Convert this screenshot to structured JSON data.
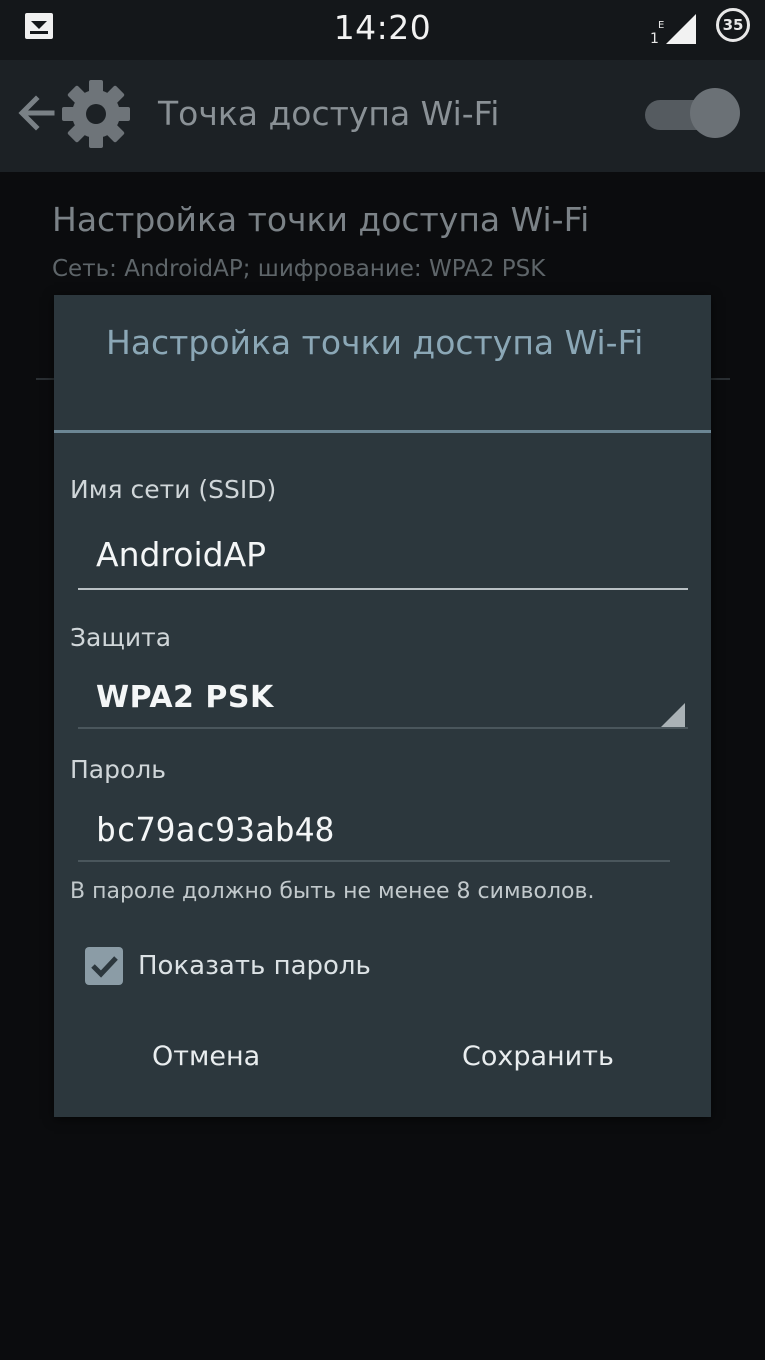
{
  "status_bar": {
    "time": "14:20",
    "battery": "35",
    "icons": [
      "download-notification-icon",
      "signal-icon",
      "battery-icon"
    ]
  },
  "action_bar": {
    "title": "Точка доступа Wi-Fi",
    "toggle_on": true,
    "icons": [
      "back-arrow-icon",
      "gear-icon"
    ]
  },
  "background": {
    "setting_title": "Настройка точки доступа Wi-Fi",
    "setting_summary": "Сеть: AndroidAP; шифрование: WPA2 PSK"
  },
  "dialog": {
    "title": "Настройка точки доступа Wi-Fi",
    "ssid_label": "Имя сети (SSID)",
    "ssid_value": "AndroidAP",
    "security_label": "Защита",
    "security_value": "WPA2 PSK",
    "password_label": "Пароль",
    "password_value": "bc79ac93ab48",
    "password_hint": "В пароле должно быть не менее 8 символов.",
    "show_password_label": "Показать пароль",
    "show_password_checked": true,
    "cancel_label": "Отмена",
    "save_label": "Сохранить"
  },
  "colors": {
    "background": "#0b0c0e",
    "action_bar": "#1c2125",
    "dialog": "#2c373d",
    "dialog_accent": "#8ba7b6"
  }
}
